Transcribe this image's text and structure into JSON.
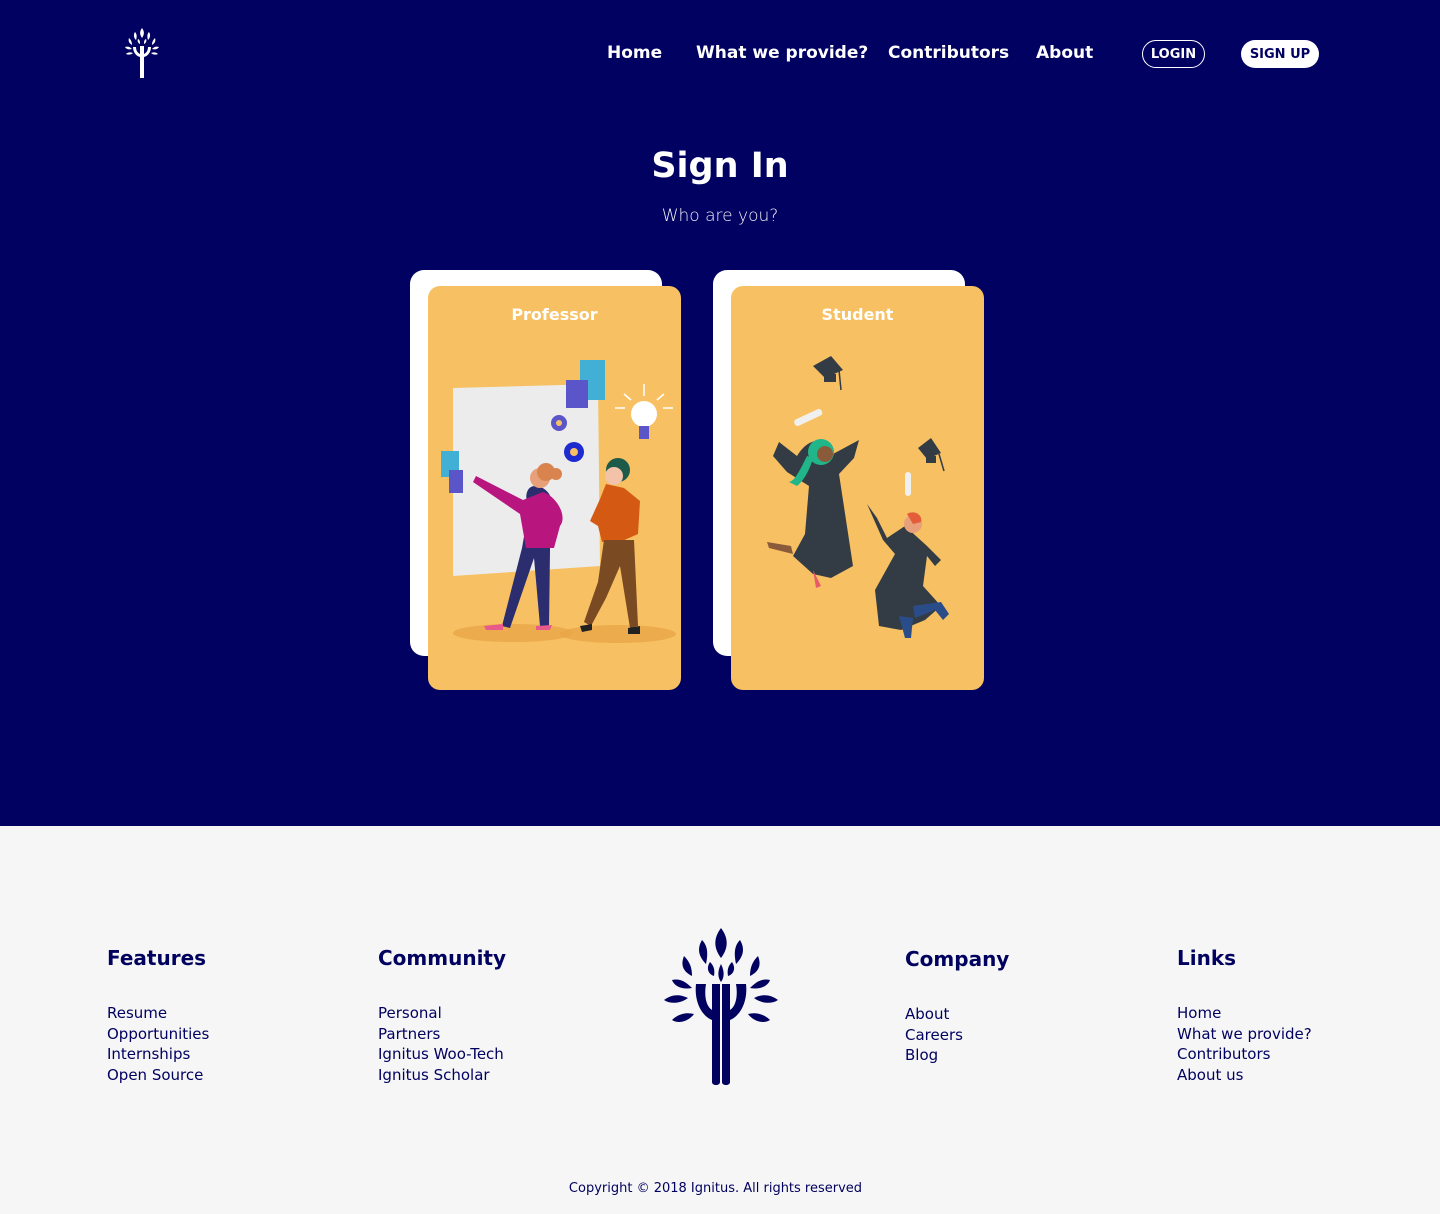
{
  "brand": {
    "primary": "#010162",
    "card": "#f7c062",
    "footer_bg": "#f6f6f6"
  },
  "header": {
    "nav": [
      {
        "label": "Home"
      },
      {
        "label": "What we provide?"
      },
      {
        "label": "Contributors"
      },
      {
        "label": "About"
      }
    ],
    "login_label": "LOGIN",
    "signup_label": "SIGN UP"
  },
  "main": {
    "title": "Sign In",
    "subtitle": "Who are you?",
    "cards": [
      {
        "label": "Professor",
        "illustration": "professors-at-whiteboard"
      },
      {
        "label": "Student",
        "illustration": "graduates-jumping"
      }
    ]
  },
  "footer": {
    "columns": [
      {
        "heading": "Features",
        "links": [
          "Resume",
          "Opportunities",
          "Internships",
          "Open Source"
        ]
      },
      {
        "heading": "Community",
        "links": [
          "Personal",
          "Partners",
          "Ignitus Woo-Tech",
          "Ignitus Scholar"
        ]
      },
      {
        "heading": "Company",
        "links": [
          "About",
          "Careers",
          "Blog"
        ]
      },
      {
        "heading": "Links",
        "links": [
          "Home",
          "What we provide?",
          "Contributors",
          "About us"
        ]
      }
    ],
    "copyright": "Copyright © 2018 Ignitus. All rights reserved"
  }
}
